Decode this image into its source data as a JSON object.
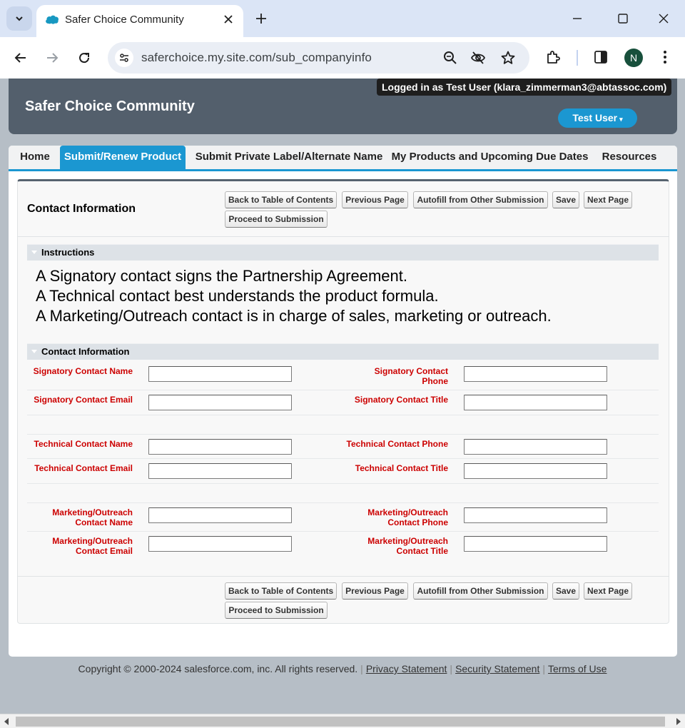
{
  "browser": {
    "tab_title": "Safer Choice Community",
    "url": "saferchoice.my.site.com/sub_companyinfo",
    "profile_initial": "N"
  },
  "header": {
    "site_title": "Safer Choice Community",
    "logged_in_text": "Logged in as Test User (klara_zimmerman3@abtassoc.com)",
    "user_menu_label": "Test User",
    "user_menu_caret": "▾"
  },
  "nav": {
    "tabs": [
      {
        "label": "Home",
        "active": false
      },
      {
        "label": "Submit/Renew Product",
        "active": true
      },
      {
        "label": "Submit Private Label/Alternate Name",
        "active": false
      },
      {
        "label": "My Products and Upcoming Due Dates",
        "active": false
      },
      {
        "label": "Resources",
        "active": false
      }
    ]
  },
  "block": {
    "title": "Contact Information",
    "buttons": {
      "back": "Back to Table of Contents",
      "previous": "Previous Page",
      "autofill": "Autofill from Other Submission",
      "save": "Save",
      "next": "Next Page",
      "proceed": "Proceed to Submission"
    }
  },
  "instructions": {
    "section_label": "Instructions",
    "lines": [
      "A Signatory contact signs the Partnership Agreement.",
      "A Technical contact best understands the product formula.",
      "A Marketing/Outreach contact is in charge of sales, marketing or outreach."
    ]
  },
  "contact_section": {
    "section_label": "Contact Information",
    "fields": {
      "signatory_name": {
        "label": "Signatory Contact Name",
        "value": ""
      },
      "signatory_phone": {
        "label": "Signatory Contact Phone",
        "value": ""
      },
      "signatory_email": {
        "label": "Signatory Contact Email",
        "value": ""
      },
      "signatory_title": {
        "label": "Signatory Contact Title",
        "value": ""
      },
      "technical_name": {
        "label": "Technical Contact Name",
        "value": ""
      },
      "technical_phone": {
        "label": "Technical Contact Phone",
        "value": ""
      },
      "technical_email": {
        "label": "Technical Contact Email",
        "value": ""
      },
      "technical_title": {
        "label": "Technical Contact Title",
        "value": ""
      },
      "marketing_name": {
        "label": "Marketing/Outreach Contact Name",
        "value": ""
      },
      "marketing_phone": {
        "label": "Marketing/Outreach Contact Phone",
        "value": ""
      },
      "marketing_email": {
        "label": "Marketing/Outreach Contact Email",
        "value": ""
      },
      "marketing_title": {
        "label": "Marketing/Outreach Contact Title",
        "value": ""
      }
    }
  },
  "footer": {
    "copyright": "Copyright © 2000-2024 salesforce.com, inc. All rights reserved.",
    "privacy": "Privacy Statement",
    "security": "Security Statement",
    "terms": "Terms of Use"
  },
  "colors": {
    "accent": "#1b97d1",
    "header_bg": "#535f6c",
    "required_label": "#cc0000"
  }
}
